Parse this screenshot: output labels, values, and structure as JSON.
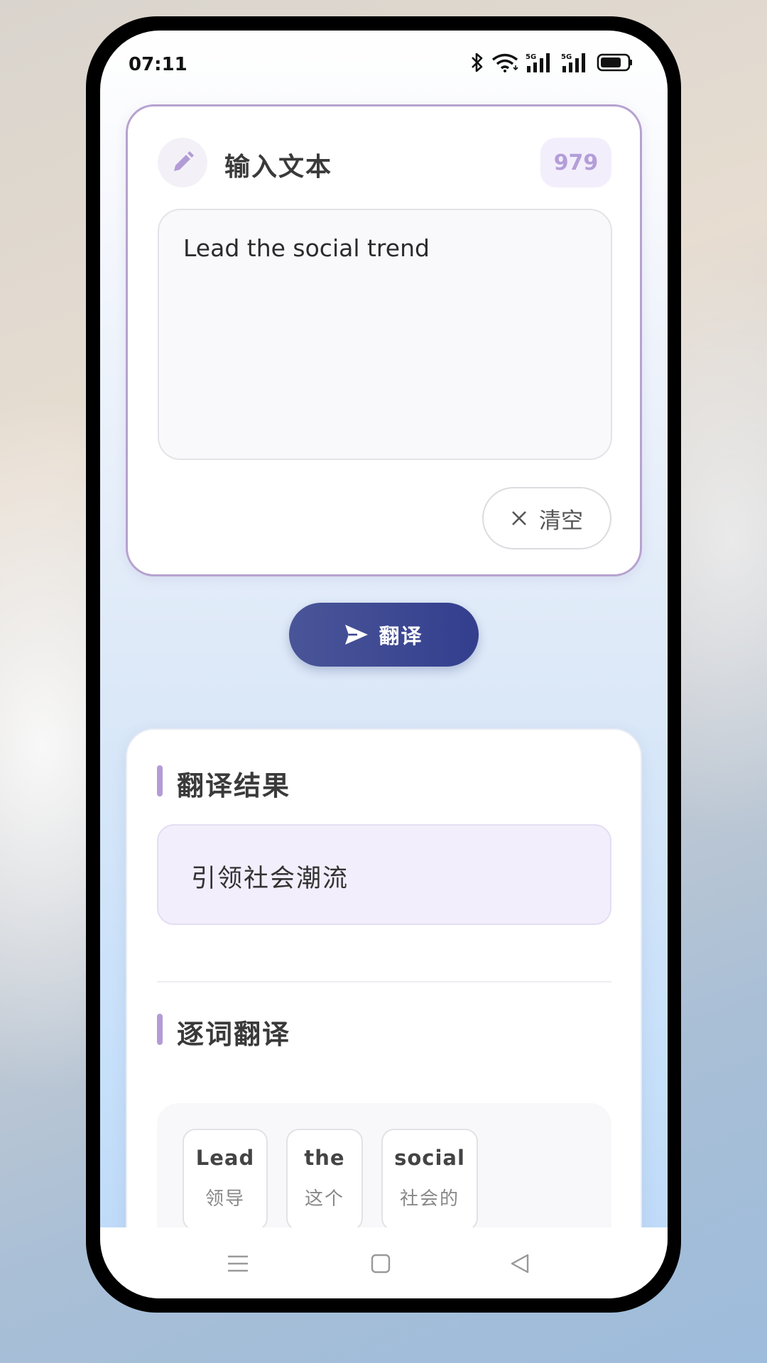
{
  "status_bar": {
    "time": "07:11",
    "icons": [
      "bluetooth-icon",
      "wifi-icon",
      "signal-5g-icon",
      "signal-5g-icon",
      "battery-icon"
    ]
  },
  "input_card": {
    "title": "输入文本",
    "char_count": "979",
    "text": "Lead the social trend",
    "clear_label": "清空",
    "colors": {
      "border": "#b6a2cf",
      "accent": "#b39ed8"
    }
  },
  "translate_button": {
    "label": "翻译",
    "color": "#3a4690"
  },
  "result": {
    "title": "翻译结果",
    "translation": "引领社会潮流"
  },
  "word_by_word": {
    "title": "逐词翻译",
    "words": [
      {
        "word": "Lead",
        "translation": "领导"
      },
      {
        "word": "the",
        "translation": "这个"
      },
      {
        "word": "social",
        "translation": "社会的"
      }
    ]
  },
  "nav": {
    "icons": [
      "menu-icon",
      "home-icon",
      "back-icon"
    ]
  }
}
